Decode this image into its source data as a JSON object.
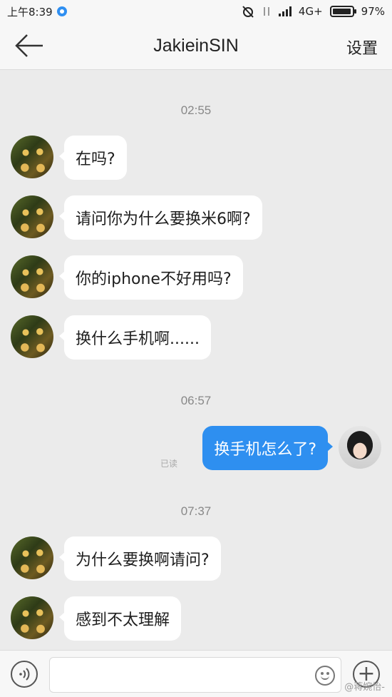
{
  "status_bar": {
    "time": "上午8:39",
    "network": "4G+",
    "battery": "97%",
    "battery_level": 0.97
  },
  "header": {
    "back_icon": "arrow-left-icon",
    "title": "JakieinSIN",
    "settings_label": "设置"
  },
  "chat": {
    "groups": [
      {
        "timestamp": "02:55",
        "messages": [
          {
            "direction": "in",
            "text": "在吗?"
          },
          {
            "direction": "in",
            "text": "请问你为什么要换米6啊?"
          },
          {
            "direction": "in",
            "text": "你的iphone不好用吗?"
          },
          {
            "direction": "in",
            "text": "换什么手机啊......"
          }
        ]
      },
      {
        "timestamp": "06:57",
        "messages": [
          {
            "direction": "out",
            "text": "换手机怎么了?",
            "status": "已读"
          }
        ]
      },
      {
        "timestamp": "07:37",
        "messages": [
          {
            "direction": "in",
            "text": "为什么要换啊请问?"
          },
          {
            "direction": "in",
            "text": "感到不太理解"
          }
        ]
      }
    ]
  },
  "input_bar": {
    "value": "",
    "placeholder": "",
    "voice_icon": "voice-icon",
    "emoji_icon": "emoji-icon",
    "plus_icon": "plus-icon",
    "plus_glyph": "+"
  },
  "watermark": "@蒋婉怡-",
  "colors": {
    "outgoing_bubble": "#2e8ff0",
    "incoming_bubble": "#ffffff",
    "background": "#ebebeb"
  }
}
